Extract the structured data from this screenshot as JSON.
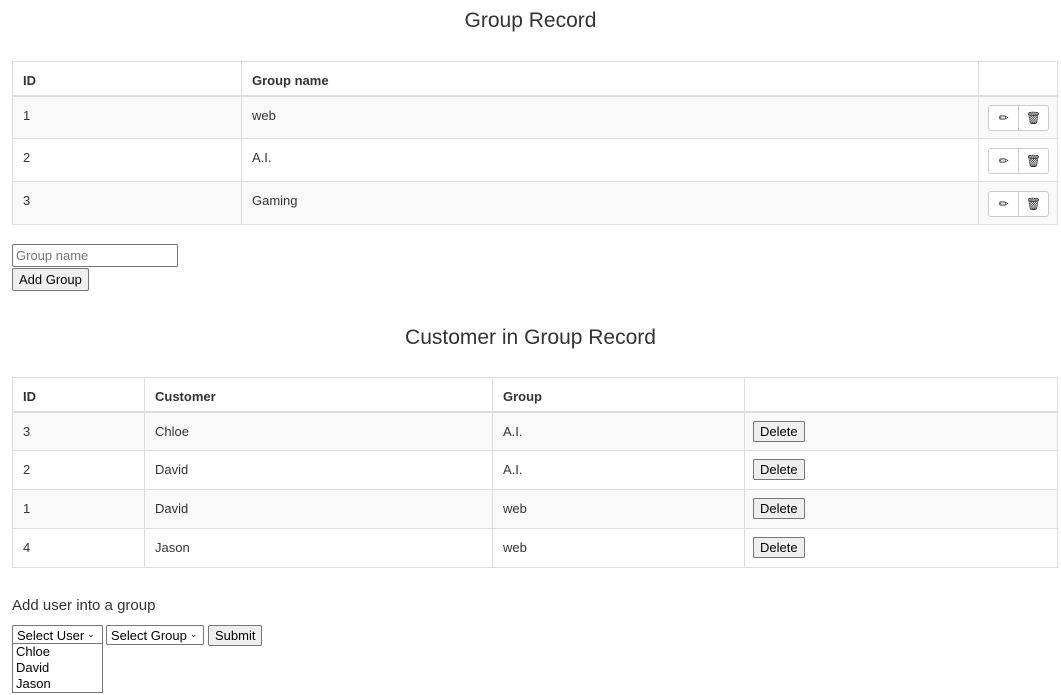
{
  "group_section": {
    "title": "Group Record",
    "columns": [
      "ID",
      "Group name",
      ""
    ],
    "rows": [
      {
        "id": "1",
        "name": "web"
      },
      {
        "id": "2",
        "name": "A.I."
      },
      {
        "id": "3",
        "name": "Gaming"
      }
    ],
    "edit_icon": "✏",
    "delete_icon": "🗑",
    "input_placeholder": "Group name",
    "add_button_label": "Add Group"
  },
  "customer_section": {
    "title": "Customer in Group Record",
    "columns": [
      "ID",
      "Customer",
      "Group",
      ""
    ],
    "rows": [
      {
        "id": "3",
        "customer": "Chloe",
        "group": "A.I.",
        "action": "Delete"
      },
      {
        "id": "2",
        "customer": "David",
        "group": "A.I.",
        "action": "Delete"
      },
      {
        "id": "1",
        "customer": "David",
        "group": "web",
        "action": "Delete"
      },
      {
        "id": "4",
        "customer": "Jason",
        "group": "web",
        "action": "Delete"
      }
    ]
  },
  "add_user_form": {
    "title": "Add user into a group",
    "user_select_value": "Select User",
    "group_select_value": "Select Group",
    "submit_label": "Submit",
    "user_options": [
      "Chloe",
      "David",
      "Jason"
    ]
  }
}
